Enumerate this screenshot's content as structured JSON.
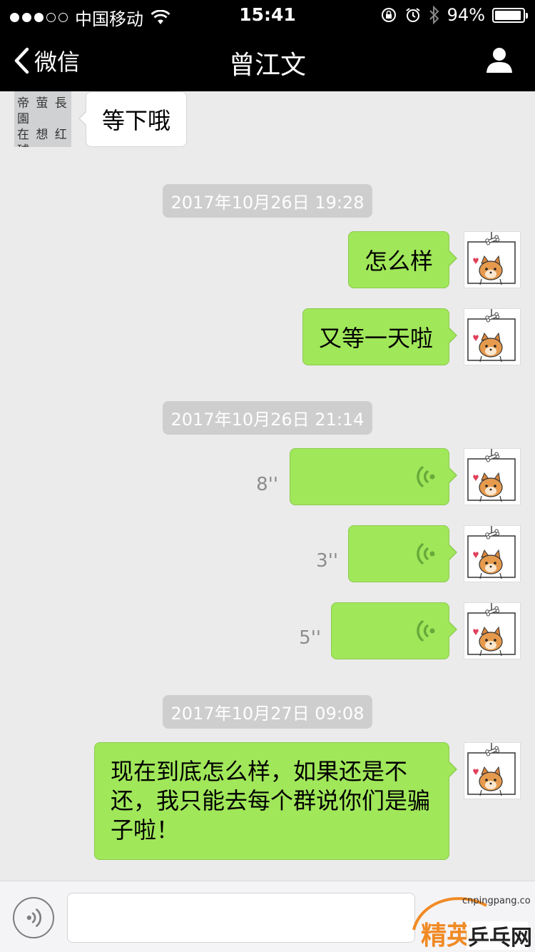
{
  "status_bar": {
    "carrier": "中国移动",
    "time": "15:41",
    "battery": "94%",
    "battery_level": 0.94,
    "signal_bars_filled": 3,
    "signal_bars_total": 5
  },
  "nav": {
    "back_label": "微信",
    "title": "曾江文"
  },
  "contact_avatar_text": [
    "帝 萤 長 園",
    "在 想 红 球"
  ],
  "messages": {
    "incoming_1": "等下哦",
    "ts_1": "2017年10月26日 19:28",
    "out_1": "怎么样",
    "out_2": "又等一天啦",
    "ts_2": "2017年10月26日 21:14",
    "voice_1_duration": "8''",
    "voice_2_duration": "3''",
    "voice_3_duration": "5''",
    "ts_3": "2017年10月27日 09:08",
    "out_long": "现在到底怎么样，如果还是不还，我只能去每个群说你们是骗子啦！"
  },
  "input": {
    "placeholder": ""
  },
  "watermark": {
    "brand": "精英乒乓网",
    "url": "cnpingpang.com"
  },
  "colors": {
    "bubble_out": "#a0e75a",
    "bubble_in": "#ffffff",
    "background": "#ebebeb",
    "nav": "#000000"
  },
  "icons": [
    "back-chevron-icon",
    "profile-icon",
    "wifi-icon",
    "lock-rotation-icon",
    "alarm-icon",
    "bluetooth-icon",
    "battery-icon",
    "voice-wave-icon",
    "voice-toggle-icon"
  ]
}
